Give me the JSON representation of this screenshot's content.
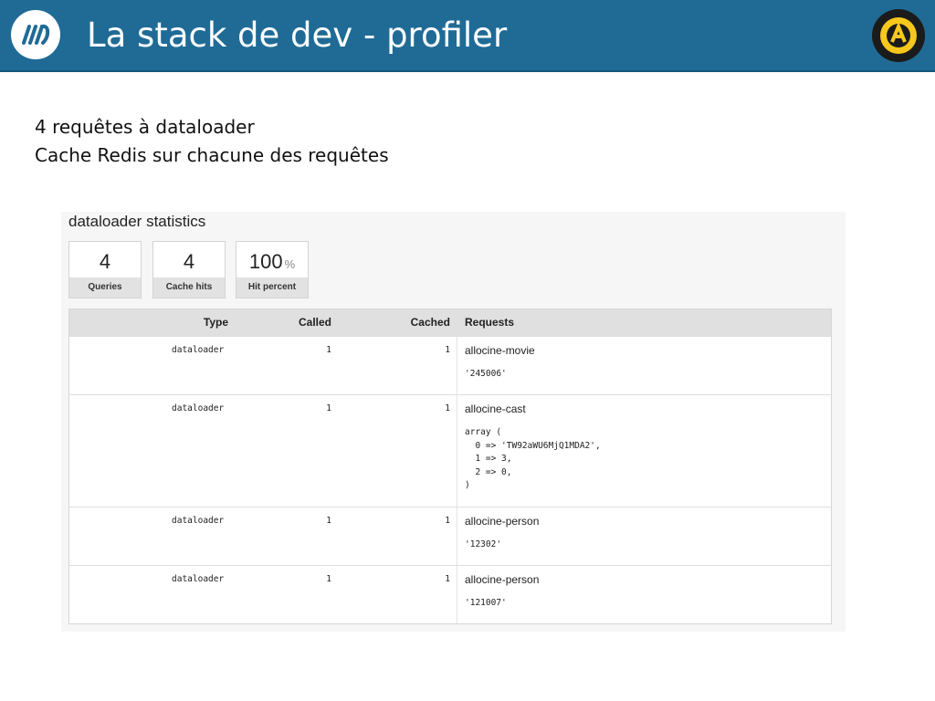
{
  "header": {
    "title": "La stack de dev - profiler",
    "colors": {
      "bar": "#1f6b96",
      "text": "#ffffff"
    },
    "left_logo_icon": "m6-logo-icon",
    "right_logo_icon": "allocine-logo-icon"
  },
  "intro": {
    "line1": "4 requêtes à dataloader",
    "line2": "Cache Redis sur chacune des requêtes"
  },
  "panel": {
    "title": "dataloader statistics",
    "metrics": [
      {
        "value": "4",
        "label": "Queries"
      },
      {
        "value": "4",
        "label": "Cache hits"
      },
      {
        "value": "100",
        "unit": "%",
        "label": "Hit percent"
      }
    ],
    "table": {
      "headers": {
        "type": "Type",
        "called": "Called",
        "cached": "Cached",
        "requests": "Requests"
      },
      "rows": [
        {
          "type": "dataloader",
          "called": "1",
          "cached": "1",
          "request": "allocine-movie",
          "args": "'245006'"
        },
        {
          "type": "dataloader",
          "called": "1",
          "cached": "1",
          "request": "allocine-cast",
          "args": "array (\n  0 => 'TW92aWU6MjQ1MDA2',\n  1 => 3,\n  2 => 0,\n)"
        },
        {
          "type": "dataloader",
          "called": "1",
          "cached": "1",
          "request": "allocine-person",
          "args": "'12302'"
        },
        {
          "type": "dataloader",
          "called": "1",
          "cached": "1",
          "request": "allocine-person",
          "args": "'121007'"
        }
      ]
    }
  }
}
